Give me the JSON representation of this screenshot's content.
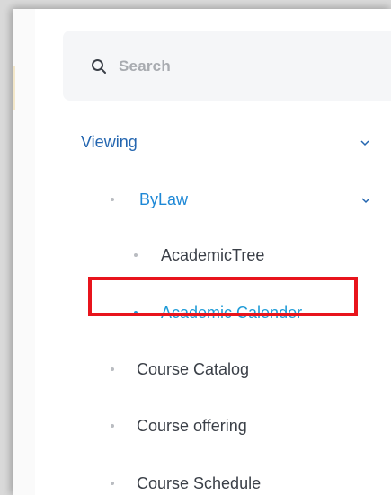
{
  "search": {
    "placeholder": "Search",
    "icon": "search-icon"
  },
  "menu": {
    "viewing": {
      "label": "Viewing",
      "expanded": true
    },
    "bylaw": {
      "label": "ByLaw",
      "expanded": true
    },
    "items": [
      {
        "label": "AcademicTree"
      },
      {
        "label": "Academic Calender",
        "active": true
      },
      {
        "label": "Course Catalog"
      },
      {
        "label": "Course offering"
      },
      {
        "label": "Course Schedule"
      }
    ]
  },
  "colors": {
    "accent_blue": "#1e9bd7",
    "section_blue": "#2466b0",
    "highlight_red": "#e8141c",
    "text_dark": "#3a3f47",
    "muted": "#a8abb0"
  }
}
